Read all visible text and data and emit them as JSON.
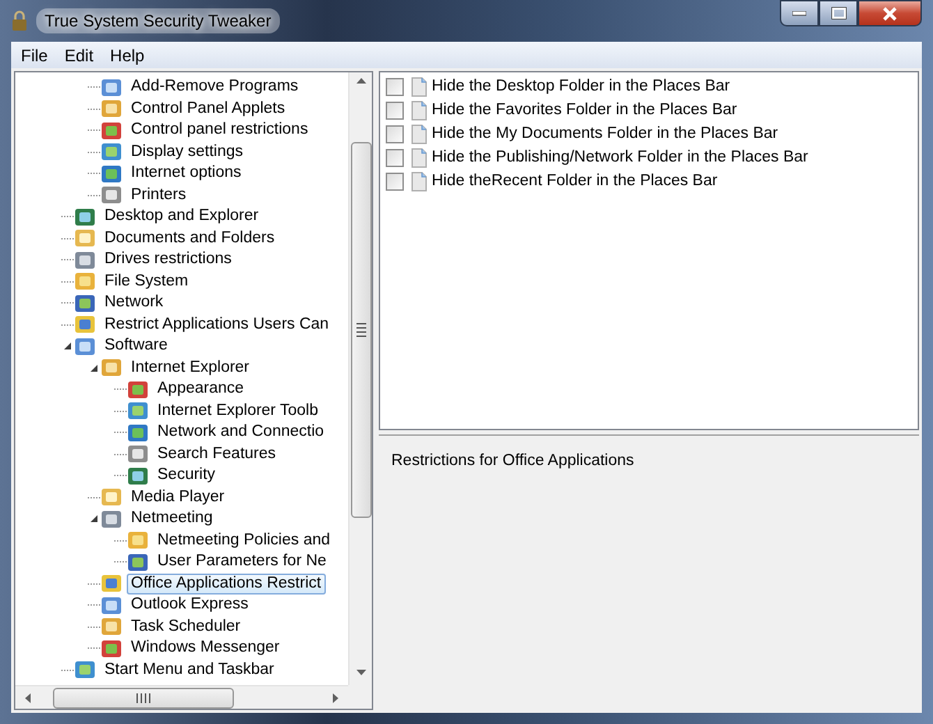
{
  "window": {
    "title": "True System Security Tweaker"
  },
  "menu": [
    "File",
    "Edit",
    "Help"
  ],
  "tree": [
    {
      "children": [
        {
          "label": "Add-Remove Programs",
          "selected": false
        },
        {
          "label": "Control Panel Applets",
          "selected": false
        },
        {
          "label": "Control panel restrictions",
          "selected": false
        },
        {
          "label": "Display settings",
          "selected": false
        },
        {
          "label": "Internet options",
          "selected": false
        },
        {
          "label": "Printers",
          "selected": false
        }
      ]
    },
    {
      "label": "Desktop and Explorer",
      "selected": false
    },
    {
      "label": "Documents and Folders",
      "selected": false
    },
    {
      "label": "Drives restrictions",
      "selected": false
    },
    {
      "label": "File System",
      "selected": false
    },
    {
      "label": "Network",
      "selected": false
    },
    {
      "label": "Restrict Applications Users Can",
      "selected": false
    },
    {
      "label": "Software",
      "selected": false,
      "expanded": true,
      "children": [
        {
          "label": "Internet Explorer",
          "selected": false,
          "expanded": true,
          "children": [
            {
              "label": "Appearance",
              "selected": false
            },
            {
              "label": "Internet Explorer Toolb",
              "selected": false
            },
            {
              "label": "Network and Connectio",
              "selected": false
            },
            {
              "label": "Search Features",
              "selected": false
            },
            {
              "label": "Security",
              "selected": false
            }
          ]
        },
        {
          "label": "Media Player",
          "selected": false
        },
        {
          "label": "Netmeeting",
          "selected": false,
          "expanded": true,
          "children": [
            {
              "label": "Netmeeting Policies and",
              "selected": false
            },
            {
              "label": "User Parameters for Ne",
              "selected": false
            }
          ]
        },
        {
          "label": "Office Applications Restrict",
          "selected": true
        },
        {
          "label": "Outlook Express",
          "selected": false
        },
        {
          "label": "Task Scheduler",
          "selected": false
        },
        {
          "label": "Windows Messenger",
          "selected": false
        }
      ]
    },
    {
      "label": "Start Menu and Taskbar",
      "selected": false
    }
  ],
  "options": [
    {
      "label": "Hide the Desktop Folder in the Places Bar",
      "checked": false
    },
    {
      "label": "Hide the Favorites Folder in the Places Bar",
      "checked": false
    },
    {
      "label": "Hide the My Documents Folder in the Places Bar",
      "checked": false
    },
    {
      "label": "Hide the Publishing/Network Folder in the Places Bar",
      "checked": false
    },
    {
      "label": "Hide theRecent Folder in the Places Bar",
      "checked": false
    }
  ],
  "description": "Restrictions for Office Applications"
}
